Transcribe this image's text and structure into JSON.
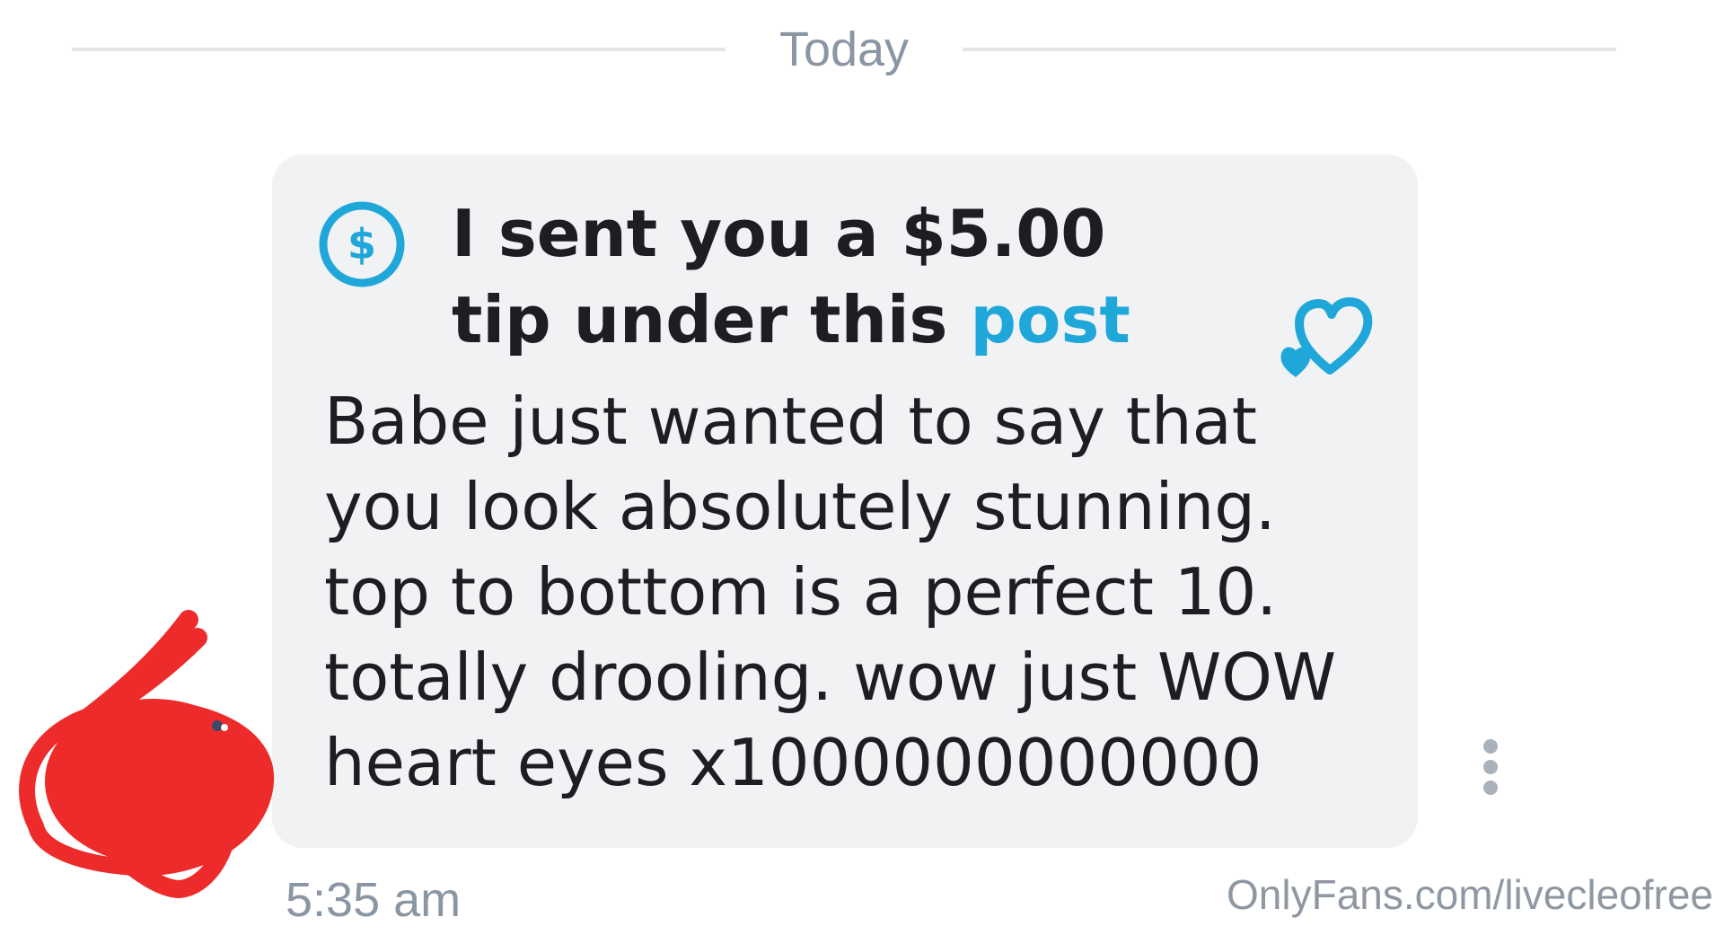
{
  "date_separator": "Today",
  "message": {
    "tip_text": "I sent you a $5.00 tip under this",
    "tip_link": "post",
    "body": "Babe just wanted to say that\nyou look absolutely stunning.\ntop to bottom is a perfect 10.\ntotally drooling. wow just WOW\nheart eyes x1000000000000",
    "time": "5:35 am"
  },
  "watermark": "OnlyFans.com/livecleofree",
  "icons": {
    "tip": "dollar-circle-icon",
    "like": "heart-outline-icon",
    "more": "vertical-dots-icon",
    "avatar": "avatar-obscured"
  },
  "colors": {
    "accent": "#1fa7d9",
    "bubble": "#f1f2f4",
    "muted_text": "#8a96a3",
    "text": "#1d1d22",
    "scribble": "#ee2b2b"
  }
}
